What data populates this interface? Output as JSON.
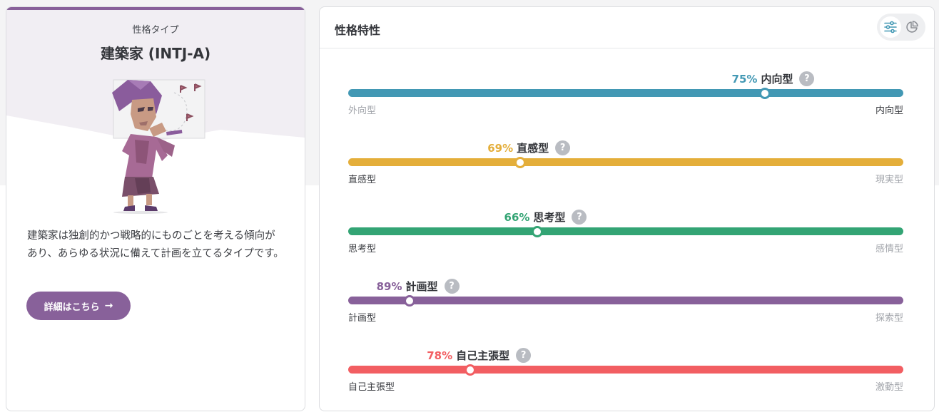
{
  "profile": {
    "kicker": "性格タイプ",
    "type_name": "建築家 (INTJ-A)",
    "description": "建築家は独創的かつ戦略的にものごとを考える傾向があり、あらゆる状況に備えて計画を立てるタイプです。",
    "detail_button": "詳細はこちら",
    "accent": "#88619a"
  },
  "traits_panel": {
    "title": "性格特性",
    "view_toggle": [
      {
        "icon": "sliders-icon",
        "active": true
      },
      {
        "icon": "pie-chart-icon",
        "active": false
      }
    ],
    "traits": [
      {
        "percent": "75%",
        "name": "内向型",
        "value": 75,
        "position": 0.75,
        "color": "#4298b4",
        "left": "外向型",
        "right": "内向型",
        "active_side": "right"
      },
      {
        "percent": "69%",
        "name": "直感型",
        "value": 69,
        "position": 0.31,
        "color": "#e4ae3a",
        "left": "直感型",
        "right": "現実型",
        "active_side": "left"
      },
      {
        "percent": "66%",
        "name": "思考型",
        "value": 66,
        "position": 0.34,
        "color": "#33a474",
        "left": "思考型",
        "right": "感情型",
        "active_side": "left"
      },
      {
        "percent": "89%",
        "name": "計画型",
        "value": 89,
        "position": 0.11,
        "color": "#88619a",
        "left": "計画型",
        "right": "探索型",
        "active_side": "left"
      },
      {
        "percent": "78%",
        "name": "自己主張型",
        "value": 78,
        "position": 0.22,
        "color": "#f25e62",
        "left": "自己主張型",
        "right": "激動型",
        "active_side": "left"
      }
    ]
  }
}
